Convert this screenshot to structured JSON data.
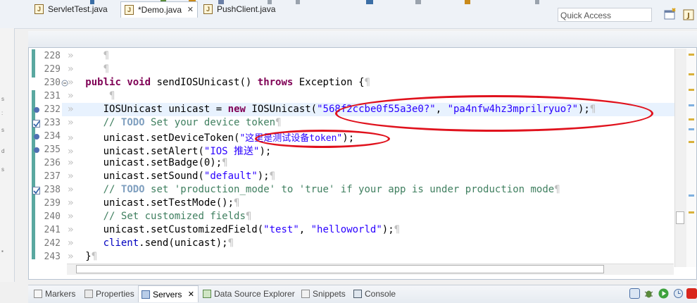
{
  "toolbar": {
    "quick_access_placeholder": "Quick Access"
  },
  "editor_tabs": [
    {
      "label": "ServletTest.java"
    },
    {
      "label": "*Demo.java"
    },
    {
      "label": "PushClient.java"
    }
  ],
  "tab_close_glyph": "✕",
  "code": {
    "pilcrow": "¶",
    "tab_glyph": "»",
    "line_numbers": [
      "228",
      "229",
      "230",
      "231",
      "232",
      "233",
      "234",
      "235",
      "236",
      "237",
      "238",
      "239",
      "240",
      "241",
      "242",
      "243"
    ],
    "l230": {
      "kw1": "public",
      "kw2": "void",
      "name": "sendIOSUnicast()",
      "kw3": "throws",
      "rest": "Exception {"
    },
    "l232": {
      "type": "IOSUnicast",
      "var": "unicast",
      "eq": "=",
      "kw": "new",
      "ctor": "IOSUnicast(",
      "s1": "\"568f2ccbe0f55a3e0?\"",
      "comma": ",",
      "s2": "\"pa4nfw4hz3mprilryuo?\"",
      "end": ");"
    },
    "l233": {
      "slashes": "//",
      "todo": "TODO",
      "text": "Set your device token"
    },
    "l234": {
      "call": "unicast.setDeviceToken(",
      "str": "\"这里是测试设备token\"",
      "end": ");"
    },
    "l235": {
      "call": "unicast.setAlert(",
      "str": "\"IOS 推送\"",
      "end": ");"
    },
    "l236": {
      "text": "unicast.setBadge(0);"
    },
    "l237": {
      "call": "unicast.setSound(",
      "str": "\"default\"",
      "end": ");"
    },
    "l238": {
      "slashes": "//",
      "todo": "TODO",
      "text": "set 'production_mode' to 'true' if your app is under production mode"
    },
    "l239": {
      "text": "unicast.setTestMode();"
    },
    "l240": {
      "slashes": "//",
      "text": "Set customized fields"
    },
    "l241": {
      "call": "unicast.setCustomizedField(",
      "s1": "\"test\"",
      "comma": ",",
      "s2": "\"helloworld\"",
      "end": ");"
    },
    "l242": {
      "field": "client",
      "rest": ".send(unicast);"
    },
    "l243": {
      "text": "}"
    }
  },
  "bottom_tabs": [
    {
      "label": "Markers"
    },
    {
      "label": "Properties"
    },
    {
      "label": "Servers"
    },
    {
      "label": "Data Source Explorer"
    },
    {
      "label": "Snippets"
    },
    {
      "label": "Console"
    }
  ],
  "colors": {
    "annotation": "#e0121d",
    "keyword": "#7f0055",
    "string": "#2a00ff",
    "comment": "#3f7f5f",
    "todo": "#7f9fbf"
  },
  "icons": [
    "perspective-icon",
    "java-file-icon",
    "close-icon",
    "markers-icon",
    "properties-icon",
    "servers-icon",
    "data-source-icon",
    "snippets-icon",
    "console-icon",
    "debug-icon",
    "run-icon",
    "stop-icon"
  ]
}
